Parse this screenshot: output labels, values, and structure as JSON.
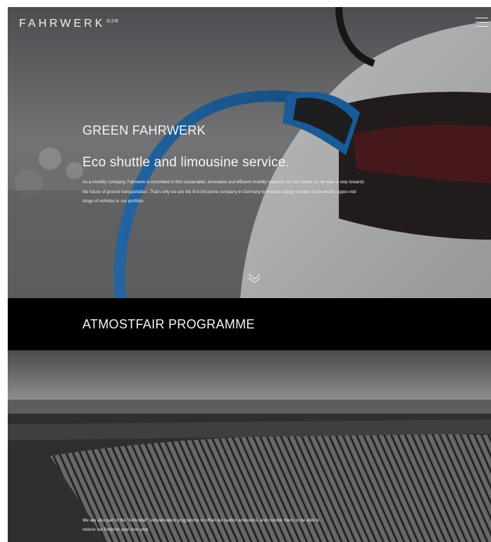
{
  "header": {
    "logo_text": "FAHRWERK",
    "logo_suffix": "G2R",
    "menu_icon": "hamburger-menu-icon"
  },
  "hero": {
    "kicker": "GREEN FAHRWERK",
    "title": "Eco shuttle and limousine service.",
    "text": "As a mobility company, Fahrwerk is commited to find sustainable, innovative and efficient mobility solutions for our clients, so we take a step towards the future of ground transportation. That's why we are the first limousine company in Germany to include a large number of all-electric upper-mid range of vehicles in our portfolio.",
    "scroll_icon": "double-chevron-down-icon"
  },
  "programme": {
    "title": "ATMOSTFAIR PROGRAMME",
    "text": "We are also part of the \"Atmosfair\" compensation programme to offset our carbon emissions, and monitor them, to be able to reduce our footprint year over year."
  },
  "colors": {
    "band_background": "#000000",
    "cable_blue": "#1f6fb8",
    "text": "#f4f4f4"
  }
}
